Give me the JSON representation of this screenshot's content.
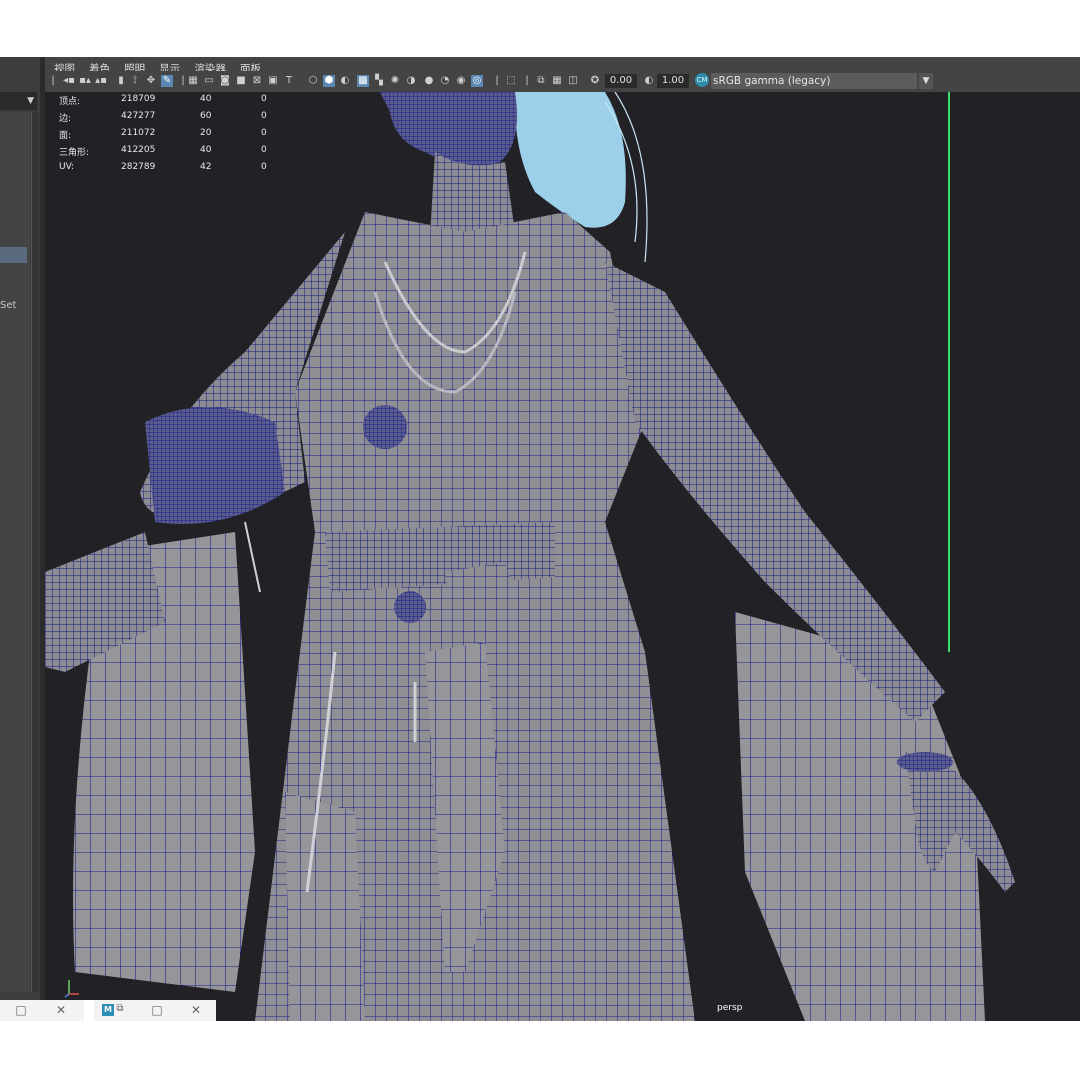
{
  "menubar": {
    "items": [
      "视图",
      "着色",
      "照明",
      "显示",
      "渲染器",
      "面板"
    ]
  },
  "toolbar": {
    "exposure_value": "0.00",
    "gamma_value": "1.00",
    "colorspace": "sRGB gamma (legacy)",
    "icons": [
      "camera-icon",
      "bookmark-icon",
      "grid-icon",
      "wireframe-icon",
      "shaded-icon",
      "light-icon",
      "isolate-icon",
      "exposure-icon",
      "gamma-icon"
    ]
  },
  "left_panel": {
    "set_label": "Set"
  },
  "hud": {
    "rows": [
      {
        "label": "顶点:",
        "total": "218709",
        "selected": "40",
        "extra": "0"
      },
      {
        "label": "边:",
        "total": "427277",
        "selected": "60",
        "extra": "0"
      },
      {
        "label": "面:",
        "total": "211072",
        "selected": "20",
        "extra": "0"
      },
      {
        "label": "三角形:",
        "total": "412205",
        "selected": "40",
        "extra": "0"
      },
      {
        "label": "UV:",
        "total": "282789",
        "selected": "42",
        "extra": "0"
      }
    ]
  },
  "viewport": {
    "camera": "persp"
  },
  "colors": {
    "wire": "#141a8a",
    "mesh": "#8e8e92",
    "hair": "#9ccfe8",
    "green_line": "#3adf6a"
  }
}
